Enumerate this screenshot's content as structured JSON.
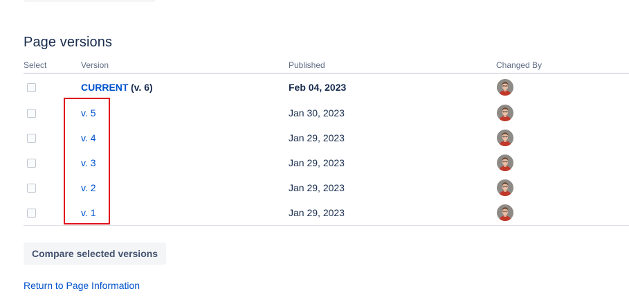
{
  "page": {
    "title": "Page versions"
  },
  "table": {
    "columns": {
      "select": "Select",
      "version": "Version",
      "published": "Published",
      "changed_by": "Changed By"
    },
    "current": {
      "label": "CURRENT",
      "suffix": "(v. 6)",
      "published": "Feb 04, 2023",
      "avatar_icon": "user-avatar"
    },
    "rows": [
      {
        "version": "v. 5",
        "published": "Jan 30, 2023",
        "avatar_icon": "user-avatar"
      },
      {
        "version": "v. 4",
        "published": "Jan 29, 2023",
        "avatar_icon": "user-avatar"
      },
      {
        "version": "v. 3",
        "published": "Jan 29, 2023",
        "avatar_icon": "user-avatar"
      },
      {
        "version": "v. 2",
        "published": "Jan 29, 2023",
        "avatar_icon": "user-avatar"
      },
      {
        "version": "v. 1",
        "published": "Jan 29, 2023",
        "avatar_icon": "user-avatar"
      }
    ]
  },
  "actions": {
    "compare_label": "Compare selected versions",
    "return_label": "Return to Page Information"
  },
  "colors": {
    "link": "#0052cc",
    "text": "#172b4d",
    "muted": "#5e6c84",
    "highlight": "#e0101a"
  }
}
